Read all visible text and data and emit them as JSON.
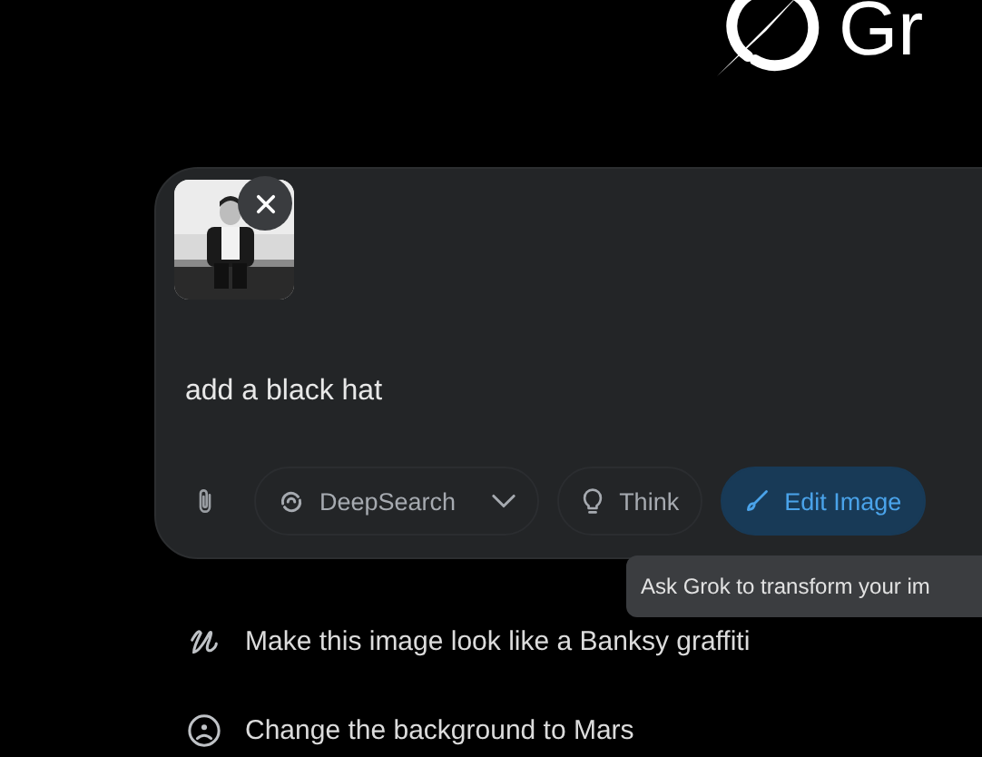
{
  "logo": {
    "text": "Gr"
  },
  "composer": {
    "value": "add a black hat",
    "toolbar": [
      {
        "kind": "dropdown",
        "label": "DeepSearch",
        "selected": false
      },
      {
        "kind": "toggle",
        "label": "Think",
        "selected": false
      },
      {
        "kind": "toggle",
        "label": "Edit Image",
        "selected": true
      }
    ]
  },
  "tooltip": "Ask Grok to transform your im",
  "suggestions": [
    {
      "kind": "scribble",
      "text": "Make this image look like a Banksy graffiti"
    },
    {
      "kind": "face",
      "text": "Change the background to Mars"
    }
  ]
}
